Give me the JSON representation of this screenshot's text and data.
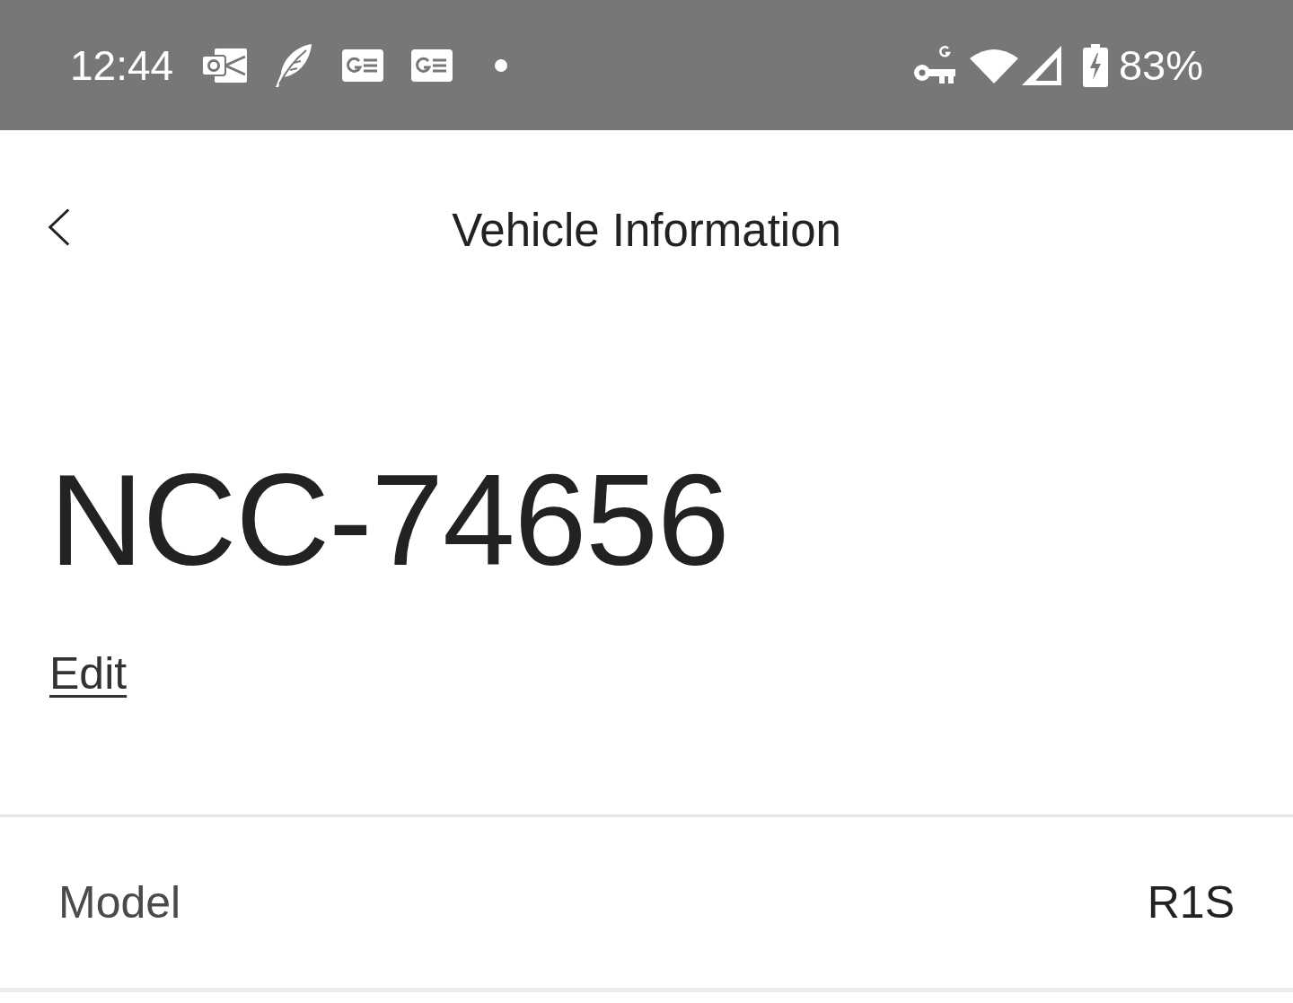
{
  "status_bar": {
    "time": "12:44",
    "battery_percent": "83%"
  },
  "header": {
    "title": "Vehicle Information"
  },
  "vehicle": {
    "name": "NCC-74656",
    "edit_link": "Edit"
  },
  "details": [
    {
      "label": "Model",
      "value": "R1S"
    }
  ]
}
